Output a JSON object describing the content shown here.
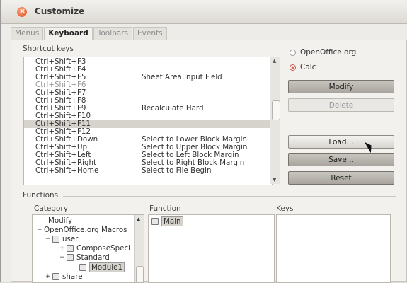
{
  "window": {
    "title": "Customize"
  },
  "tabs": [
    "Menus",
    "Keyboard",
    "Toolbars",
    "Events"
  ],
  "shortcut_section": {
    "label": "Shortcut keys"
  },
  "shortcuts": [
    {
      "key": "Ctrl+Shift+F3",
      "function": ""
    },
    {
      "key": "Ctrl+Shift+F4",
      "function": ""
    },
    {
      "key": "Ctrl+Shift+F5",
      "function": "Sheet Area Input Field"
    },
    {
      "key": "Ctrl+Shift+F6",
      "function": ""
    },
    {
      "key": "Ctrl+Shift+F7",
      "function": ""
    },
    {
      "key": "Ctrl+Shift+F8",
      "function": ""
    },
    {
      "key": "Ctrl+Shift+F9",
      "function": "Recalculate Hard"
    },
    {
      "key": "Ctrl+Shift+F10",
      "function": ""
    },
    {
      "key": "Ctrl+Shift+F11",
      "function": ""
    },
    {
      "key": "Ctrl+Shift+F12",
      "function": ""
    },
    {
      "key": "Ctrl+Shift+Down",
      "function": "Select to Lower Block Margin"
    },
    {
      "key": "Ctrl+Shift+Up",
      "function": "Select to Upper Block Margin"
    },
    {
      "key": "Ctrl+Shift+Left",
      "function": "Select to Left Block Margin"
    },
    {
      "key": "Ctrl+Shift+Right",
      "function": "Select to Right Block Margin"
    },
    {
      "key": "Ctrl+Shift+Home",
      "function": "Select to File Begin"
    }
  ],
  "scope": {
    "option1": "OpenOffice.org",
    "option2": "Calc",
    "selected": "Calc"
  },
  "buttons": {
    "modify": "Modify",
    "delete": "Delete",
    "load": "Load...",
    "save": "Save...",
    "reset": "Reset"
  },
  "functions_section": {
    "label": "Functions",
    "category_label": "Category",
    "function_label": "Function",
    "keys_label": "Keys"
  },
  "category_tree": [
    {
      "label": "Modify"
    },
    {
      "label": "OpenOffice.org Macros"
    },
    {
      "label": "user"
    },
    {
      "label": "ComposeSpeci"
    },
    {
      "label": "Standard"
    },
    {
      "label": "Module1"
    },
    {
      "label": "share"
    }
  ],
  "function_list": [
    "Main"
  ],
  "colors": {
    "accent": "#e3683a",
    "selection": "#d6d3cd"
  }
}
